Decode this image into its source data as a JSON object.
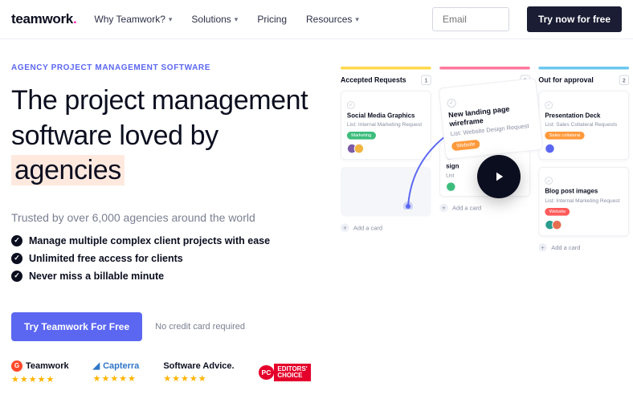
{
  "logo": {
    "text": "teamwork",
    "dot": "."
  },
  "nav": {
    "items": [
      {
        "label": "Why Teamwork?"
      },
      {
        "label": "Solutions"
      },
      {
        "label": "Pricing"
      },
      {
        "label": "Resources"
      }
    ]
  },
  "email_placeholder": "Email",
  "cta_top": "Try now for free",
  "eyebrow": "AGENCY PROJECT MANAGEMENT SOFTWARE",
  "h1_a": "The project management software loved by ",
  "h1_b": "agencies",
  "sub": "Trusted by over 6,000 agencies around the world",
  "bullets": [
    "Manage multiple complex client projects with ease",
    "Unlimited free access for clients",
    "Never miss a billable minute"
  ],
  "cta_main": "Try Teamwork For Free",
  "nocc": "No credit card required",
  "board": {
    "cols": [
      {
        "title": "Accepted Requests",
        "count": "1",
        "cards": [
          {
            "title": "Social Media Graphics",
            "list": "List: Internal Marketing Request",
            "tag": "Marketing",
            "tagc": "tag-g",
            "avatars": [
              "#7d5ba6",
              "#f2b441"
            ]
          }
        ]
      },
      {
        "title": "",
        "count": "2",
        "cards": [
          {
            "title": "sign",
            "list": "List",
            "tag": "",
            "tagc": "",
            "avatars": [
              "#3dbd7d"
            ]
          }
        ]
      },
      {
        "title": "Out for approval",
        "count": "2",
        "cards": [
          {
            "title": "Presentation Deck",
            "list": "List: Sales Collateral Requests",
            "tag": "Sales collateral",
            "tagc": "tag-o",
            "avatars": [
              "#5b67f1"
            ]
          },
          {
            "title": "Blog post images",
            "list": "List: Internal Marketing Request",
            "tag": "Website",
            "tagc": "tag-r",
            "avatars": [
              "#2a9d8f",
              "#e76f51"
            ]
          }
        ]
      }
    ],
    "addcard": "Add a card",
    "floating": {
      "title": "New landing page wireframe",
      "list": "List: Website Design Request",
      "tag": "Website",
      "tagc": "tag-o"
    }
  },
  "proof": [
    {
      "name": "Teamwork"
    },
    {
      "name": "Capterra"
    },
    {
      "name": "Software Advice."
    }
  ],
  "pc": {
    "a": "PC",
    "b": "EDITORS'",
    "c": "CHOICE"
  }
}
